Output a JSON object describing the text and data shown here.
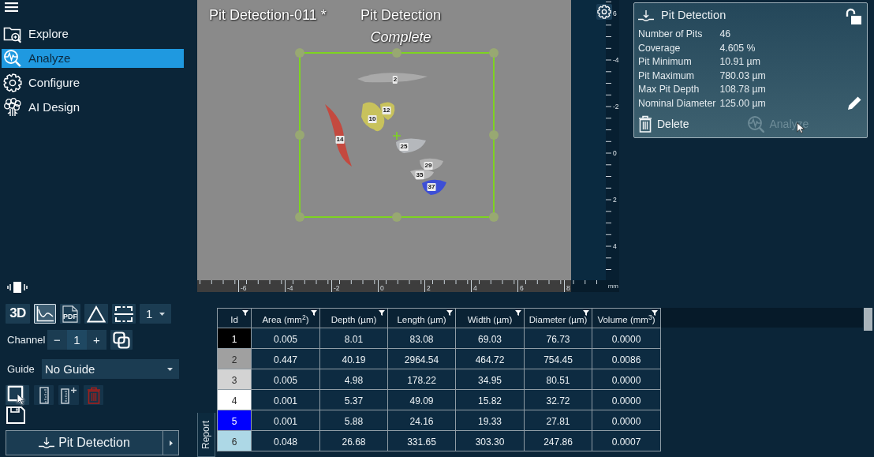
{
  "sidebar": {
    "items": [
      {
        "label": "Explore",
        "selected": false
      },
      {
        "label": "Analyze",
        "selected": true
      },
      {
        "label": "Configure",
        "selected": false
      },
      {
        "label": "AI Design",
        "selected": false
      }
    ]
  },
  "viewer": {
    "title": "Pit Detection-011 *",
    "analysis": "Pit Detection",
    "status": "Complete",
    "pits": [
      {
        "label": "2",
        "color": "#a9a9a9"
      },
      {
        "label": "10",
        "color": "#c8c25c"
      },
      {
        "label": "12",
        "color": "#c8c25c"
      },
      {
        "label": "14",
        "color": "#c4493f"
      },
      {
        "label": "25",
        "color": "#b5b8bc"
      },
      {
        "label": "29",
        "color": "#b0b0b0"
      },
      {
        "label": "35",
        "color": "#b9b9b9"
      },
      {
        "label": "37",
        "color": "#3d4fd6"
      }
    ],
    "vertical_ruler": {
      "labels": [
        "6",
        "-4",
        "-2",
        "0",
        "2",
        "4"
      ]
    },
    "horizontal_ruler": {
      "labels": [
        "-6",
        "-4",
        "-2",
        "0",
        "2",
        "4",
        "6",
        "8"
      ],
      "unit": "mm"
    }
  },
  "results_panel": {
    "title": "Pit Detection",
    "locked": false,
    "stats": [
      {
        "label": "Number of Pits",
        "value": "46"
      },
      {
        "label": "Coverage",
        "value": "4.605 %"
      },
      {
        "label": "Pit Minimum",
        "value": "10.91 µm"
      },
      {
        "label": "Pit Maximum",
        "value": "780.03 µm"
      },
      {
        "label": "Max Pit Depth",
        "value": "108.78 µm"
      },
      {
        "label": "Nominal Diameter",
        "value": "125.00 µm"
      }
    ],
    "actions": [
      {
        "label": "Delete",
        "disabled": false
      },
      {
        "label": "Analyze",
        "disabled": true
      }
    ]
  },
  "controls": {
    "view_buttons": [
      {
        "kind": "text",
        "label": "3D",
        "selected": false
      },
      {
        "kind": "chart",
        "selected": true
      },
      {
        "kind": "pdf",
        "label": "PDF",
        "selected": false
      },
      {
        "kind": "triangle",
        "selected": false
      },
      {
        "kind": "frame",
        "selected": false
      }
    ],
    "layer_dropdown": {
      "value": "1"
    },
    "channel": {
      "label": "Channel",
      "decrement": "−",
      "value": "1",
      "increment": "+"
    },
    "guide": {
      "label": "Guide",
      "value": "No Guide"
    },
    "tools": [
      {
        "kind": "select",
        "selected": true
      },
      {
        "kind": "ruler",
        "selected": false
      },
      {
        "kind": "ruler_add",
        "selected": false
      },
      {
        "kind": "delete",
        "selected": false
      }
    ],
    "run_button": {
      "label": "Pit Detection"
    }
  },
  "table": {
    "columns": [
      "Id",
      "Area (mm$^{2}$)",
      "Depth (µm)",
      "Length (µm)",
      "Width (µm)",
      "Diameter (µm)",
      "Volume (mm$^{3}$)"
    ],
    "rows": [
      {
        "color": "#000000",
        "cells": [
          "1",
          "0.005",
          "8.01",
          "83.08",
          "69.03",
          "76.73",
          "0.0000"
        ]
      },
      {
        "color": "#a0a0a0",
        "cells": [
          "2",
          "0.447",
          "40.19",
          "2964.54",
          "464.72",
          "754.45",
          "0.0086"
        ]
      },
      {
        "color": "#d3d3d3",
        "cells": [
          "3",
          "0.005",
          "4.98",
          "178.22",
          "34.95",
          "80.51",
          "0.0000"
        ]
      },
      {
        "color": "#ffffff",
        "cells": [
          "4",
          "0.001",
          "5.37",
          "49.09",
          "15.82",
          "32.72",
          "0.0000"
        ]
      },
      {
        "color": "#0000ff",
        "cells": [
          "5",
          "0.001",
          "5.88",
          "24.16",
          "19.33",
          "27.81",
          "0.0000"
        ]
      },
      {
        "color": "#add8e6",
        "cells": [
          "6",
          "0.048",
          "26.68",
          "331.65",
          "303.30",
          "247.86",
          "0.0007"
        ]
      }
    ]
  },
  "report_tab": {
    "label": "Report"
  }
}
